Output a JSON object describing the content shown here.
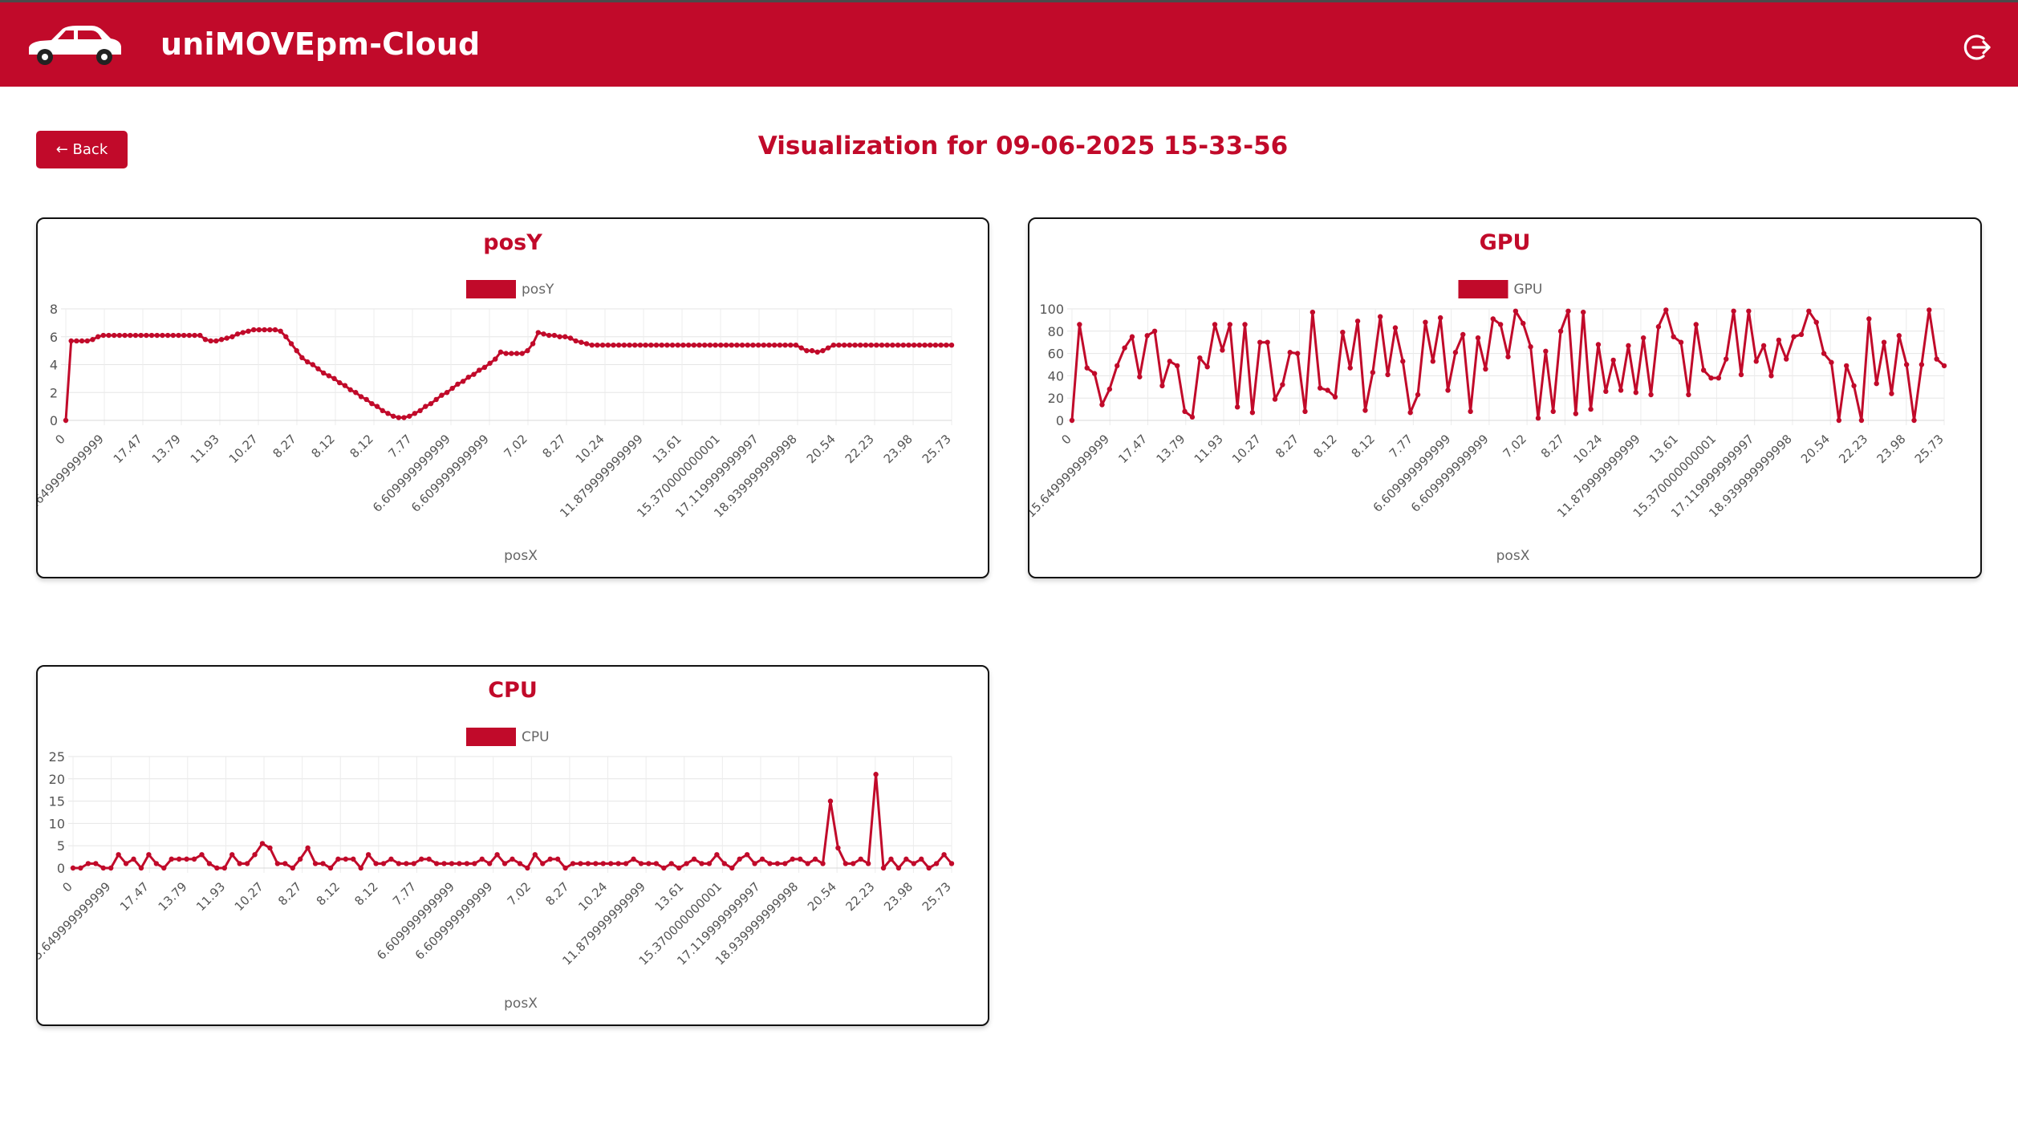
{
  "app": {
    "title": "uniMOVEpm-Cloud"
  },
  "page": {
    "back_label": "← Back",
    "title": "Visualization for 09-06-2025 15-33-56"
  },
  "colors": {
    "brand": "#c10a2a",
    "line": "#c10a2a"
  },
  "icons": {
    "logo": "car-icon",
    "logout": "logout-icon"
  },
  "chart_data": [
    {
      "type": "line",
      "title": "posY",
      "xlabel": "posX",
      "ylabel": "",
      "ylim": [
        0,
        8
      ],
      "yticks": [
        0,
        2,
        4,
        6,
        8
      ],
      "legend": "top-center",
      "grid": true,
      "x_tick_labels": [
        "0",
        "15.649999999999",
        "17.47",
        "13.79",
        "11.93",
        "10.27",
        "8.27",
        "8.12",
        "8.12",
        "7.77",
        "6.609999999999",
        "6.609999999999",
        "7.02",
        "8.27",
        "10.24",
        "11.879999999999",
        "13.61",
        "15.370000000001",
        "17.119999999997",
        "18.939999999998",
        "20.54",
        "22.23",
        "23.98",
        "25.73"
      ],
      "series": [
        {
          "name": "posY",
          "values": [
            0,
            5.7,
            5.7,
            5.7,
            5.7,
            5.8,
            6.0,
            6.1,
            6.1,
            6.1,
            6.1,
            6.1,
            6.1,
            6.1,
            6.1,
            6.1,
            6.1,
            6.1,
            6.1,
            6.1,
            6.1,
            6.1,
            6.1,
            6.1,
            6.1,
            6.1,
            5.8,
            5.7,
            5.7,
            5.8,
            5.9,
            6.0,
            6.2,
            6.3,
            6.4,
            6.5,
            6.5,
            6.5,
            6.5,
            6.5,
            6.4,
            6.0,
            5.5,
            5.0,
            4.5,
            4.2,
            4.0,
            3.7,
            3.4,
            3.2,
            3.0,
            2.7,
            2.5,
            2.2,
            2.0,
            1.7,
            1.5,
            1.2,
            1.0,
            0.7,
            0.5,
            0.3,
            0.2,
            0.2,
            0.3,
            0.5,
            0.7,
            1.0,
            1.2,
            1.5,
            1.8,
            2.0,
            2.3,
            2.6,
            2.8,
            3.1,
            3.3,
            3.6,
            3.8,
            4.1,
            4.4,
            4.9,
            4.8,
            4.8,
            4.8,
            4.8,
            5.0,
            5.5,
            6.3,
            6.2,
            6.1,
            6.1,
            6.0,
            6.0,
            5.9,
            5.7,
            5.6,
            5.5,
            5.4,
            5.4,
            5.4,
            5.4,
            5.4,
            5.4,
            5.4,
            5.4,
            5.4,
            5.4,
            5.4,
            5.4,
            5.4,
            5.4,
            5.4,
            5.4,
            5.4,
            5.4,
            5.4,
            5.4,
            5.4,
            5.4,
            5.4,
            5.4,
            5.4,
            5.4,
            5.4,
            5.4,
            5.4,
            5.4,
            5.4,
            5.4,
            5.4,
            5.4,
            5.4,
            5.4,
            5.4,
            5.4,
            5.4,
            5.2,
            5.0,
            5.0,
            4.9,
            5.0,
            5.2,
            5.4,
            5.4,
            5.4,
            5.4,
            5.4,
            5.4,
            5.4,
            5.4,
            5.4,
            5.4,
            5.4,
            5.4,
            5.4,
            5.4,
            5.4,
            5.4,
            5.4,
            5.4,
            5.4,
            5.4,
            5.4,
            5.4,
            5.4
          ]
        }
      ]
    },
    {
      "type": "line",
      "title": "GPU",
      "xlabel": "posX",
      "ylabel": "",
      "ylim": [
        0,
        100
      ],
      "yticks": [
        0,
        20,
        40,
        60,
        80,
        100
      ],
      "legend": "top-center",
      "grid": true,
      "x_tick_labels": [
        "0",
        "15.649999999999",
        "17.47",
        "13.79",
        "11.93",
        "10.27",
        "8.27",
        "8.12",
        "8.12",
        "7.77",
        "6.609999999999",
        "6.609999999999",
        "7.02",
        "8.27",
        "10.24",
        "11.879999999999",
        "13.61",
        "15.370000000001",
        "17.119999999997",
        "18.939999999998",
        "20.54",
        "22.23",
        "23.98",
        "25.73"
      ],
      "series": [
        {
          "name": "GPU",
          "values": [
            0,
            86,
            47,
            42,
            14,
            28,
            49,
            65,
            75,
            39,
            76,
            80,
            31,
            53,
            49,
            8,
            3,
            56,
            48,
            86,
            63,
            86,
            12,
            86,
            7,
            70,
            70,
            19,
            32,
            61,
            60,
            8,
            97,
            29,
            27,
            21,
            79,
            47,
            89,
            9,
            43,
            93,
            41,
            83,
            53,
            7,
            23,
            88,
            53,
            92,
            27,
            61,
            77,
            8,
            74,
            46,
            91,
            86,
            57,
            98,
            87,
            66,
            2,
            62,
            8,
            80,
            98,
            6,
            97,
            10,
            68,
            26,
            54,
            27,
            67,
            25,
            74,
            23,
            84,
            99,
            75,
            70,
            23,
            86,
            45,
            38,
            38,
            55,
            98,
            41,
            98,
            53,
            67,
            40,
            72,
            55,
            75,
            77,
            98,
            88,
            60,
            52,
            0,
            49,
            31,
            0,
            91,
            33,
            70,
            24,
            76,
            50,
            0,
            50,
            99,
            55,
            49
          ]
        }
      ]
    },
    {
      "type": "line",
      "title": "CPU",
      "xlabel": "posX",
      "ylabel": "",
      "ylim": [
        0,
        25
      ],
      "yticks": [
        0,
        5,
        10,
        15,
        20,
        25
      ],
      "legend": "top-center",
      "grid": true,
      "x_tick_labels": [
        "0",
        "15.649999999999",
        "17.47",
        "13.79",
        "11.93",
        "10.27",
        "8.27",
        "8.12",
        "8.12",
        "7.77",
        "6.609999999999",
        "6.609999999999",
        "7.02",
        "8.27",
        "10.24",
        "11.879999999999",
        "13.61",
        "15.370000000001",
        "17.119999999997",
        "18.939999999998",
        "20.54",
        "22.23",
        "23.98",
        "25.73"
      ],
      "series": [
        {
          "name": "CPU",
          "values": [
            0,
            0,
            1,
            1,
            0,
            0,
            3,
            1,
            2,
            0,
            3,
            1,
            0,
            2,
            2,
            2,
            2,
            3,
            1,
            0,
            0,
            3,
            1,
            1,
            3,
            5.5,
            4.5,
            1,
            1,
            0,
            2,
            4.5,
            1,
            1,
            0,
            2,
            2,
            2,
            0,
            3,
            1,
            1,
            2,
            1,
            1,
            1,
            2,
            2,
            1,
            1,
            1,
            1,
            1,
            1,
            2,
            1,
            3,
            1,
            2,
            1,
            0,
            3,
            1,
            2,
            2,
            0,
            1,
            1,
            1,
            1,
            1,
            1,
            1,
            1,
            2,
            1,
            1,
            1,
            0,
            1,
            0,
            1,
            2,
            1,
            1,
            3,
            1,
            0,
            2,
            3,
            1,
            2,
            1,
            1,
            1,
            2,
            2,
            1,
            2,
            1,
            15,
            4.5,
            1,
            1,
            2,
            1,
            21,
            0,
            2,
            0,
            2,
            1,
            2,
            0,
            1,
            3,
            1
          ]
        }
      ]
    }
  ]
}
